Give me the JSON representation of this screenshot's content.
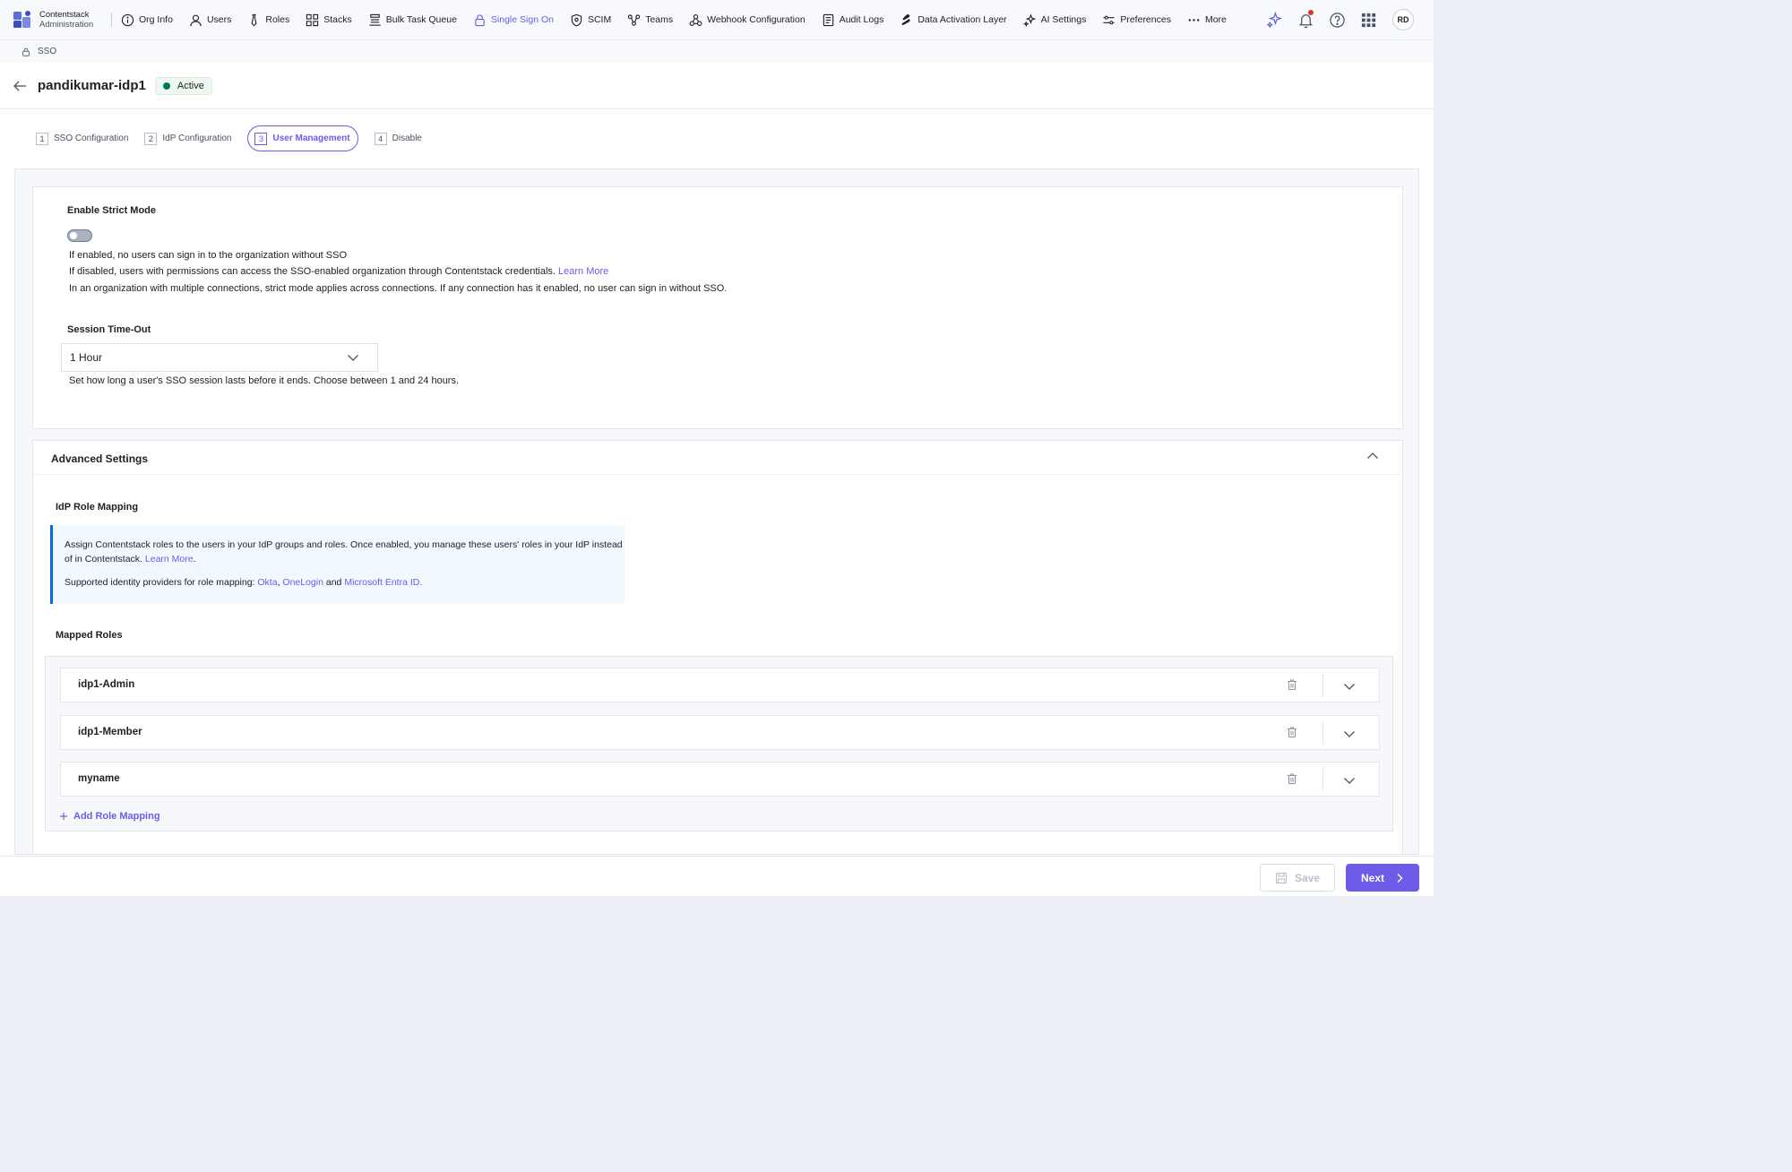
{
  "brand": {
    "name": "Contentstack",
    "sub": "Administration"
  },
  "nav": {
    "items": [
      {
        "label": "Org Info",
        "icon": "info-icon"
      },
      {
        "label": "Users",
        "icon": "user-icon"
      },
      {
        "label": "Roles",
        "icon": "tie-icon"
      },
      {
        "label": "Stacks",
        "icon": "grid-icon"
      },
      {
        "label": "Bulk Task Queue",
        "icon": "queue-icon"
      },
      {
        "label": "Single Sign On",
        "icon": "lock-icon",
        "active": true
      },
      {
        "label": "SCIM",
        "icon": "shield-icon"
      },
      {
        "label": "Teams",
        "icon": "teams-icon"
      },
      {
        "label": "Webhook Configuration",
        "icon": "webhook-icon"
      },
      {
        "label": "Audit Logs",
        "icon": "log-icon"
      },
      {
        "label": "Data Activation Layer",
        "icon": "layers-icon"
      },
      {
        "label": "AI Settings",
        "icon": "sparkle-icon"
      },
      {
        "label": "Preferences",
        "icon": "sliders-icon"
      },
      {
        "label": "More",
        "icon": "dots-icon"
      }
    ],
    "avatar_initials": "RD"
  },
  "breadcrumb": {
    "label": "SSO"
  },
  "header": {
    "title": "pandikumar-idp1",
    "status": "Active"
  },
  "steps": [
    {
      "num": "1",
      "label": "SSO Configuration"
    },
    {
      "num": "2",
      "label": "IdP Configuration"
    },
    {
      "num": "3",
      "label": "User Management",
      "active": true
    },
    {
      "num": "4",
      "label": "Disable"
    }
  ],
  "strict_mode": {
    "title": "Enable Strict Mode",
    "enabled": false,
    "line1": "If enabled, no users can sign in to the organization without SSO",
    "line2": "If disabled, users with permissions can access the SSO-enabled organization through Contentstack credentials.",
    "line2_link": "Learn More",
    "line3": "In an organization with multiple connections, strict mode applies across connections. If any connection has it enabled, no user can sign in without SSO."
  },
  "session": {
    "title": "Session Time-Out",
    "value": "1 Hour",
    "help": "Set how long a user's SSO session lasts before it ends. Choose between 1 and 24 hours."
  },
  "advanced": {
    "title": "Advanced Settings",
    "role_mapping_title": "IdP Role Mapping",
    "note_text": "Assign Contentstack roles to the users in your IdP groups and roles. Once enabled, you manage these users' roles in your IdP instead of in Contentstack.",
    "note_link": "Learn More",
    "providers_prefix": "Supported identity providers for role mapping:",
    "provider1": "Okta",
    "provider2": "OneLogin",
    "providers_and": "and",
    "provider3": "Microsoft Entra ID.",
    "mapped_title": "Mapped Roles",
    "roles": [
      "idp1-Admin",
      "idp1-Member",
      "myname"
    ],
    "add_label": "Add Role Mapping"
  },
  "footer": {
    "save": "Save",
    "next": "Next"
  },
  "colors": {
    "accent": "#6c5ce7",
    "active_green": "#007a52",
    "note_border": "#0469e3"
  }
}
